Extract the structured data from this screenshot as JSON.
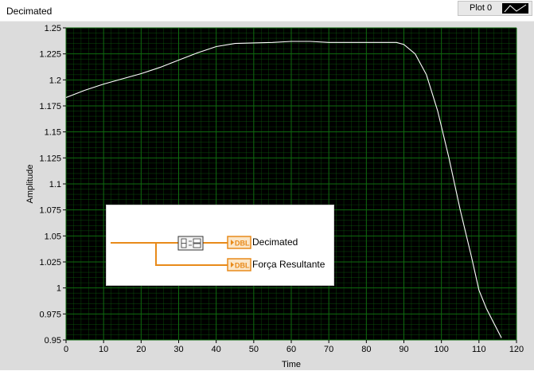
{
  "graph": {
    "title": "Decimated",
    "legend": {
      "plot_name": "Plot 0",
      "swatch_icon": "line-plot-swatch-icon"
    },
    "colors": {
      "plot_bg": "#000000",
      "grid": "#0f6b0f",
      "trace": "#ffffff",
      "wire": "#e88a1a"
    }
  },
  "chart_data": {
    "type": "line",
    "title": "Decimated",
    "xlabel": "Time",
    "ylabel": "Amplitude",
    "xlim": [
      0,
      120
    ],
    "ylim": [
      0.95,
      1.25
    ],
    "xticks": [
      "0",
      "10",
      "20",
      "30",
      "40",
      "50",
      "60",
      "70",
      "80",
      "90",
      "100",
      "110",
      "120"
    ],
    "yticks": [
      "1.25",
      "1.225",
      "1.2",
      "1.175",
      "1.15",
      "1.125",
      "1.1",
      "1.075",
      "1.05",
      "1.025",
      "1",
      "0.975",
      "0.95"
    ],
    "grid": true,
    "series": [
      {
        "x": [
          0,
          5,
          10,
          15,
          20,
          25,
          30,
          35,
          40,
          45,
          50,
          55,
          60,
          65,
          70,
          75,
          80,
          85,
          88,
          90,
          93,
          96,
          99,
          102,
          105,
          108,
          110,
          112,
          114,
          116
        ],
        "y": [
          1.183,
          1.19,
          1.196,
          1.201,
          1.206,
          1.212,
          1.219,
          1.226,
          1.232,
          1.235,
          1.2355,
          1.236,
          1.237,
          1.237,
          1.236,
          1.236,
          1.236,
          1.236,
          1.236,
          1.234,
          1.225,
          1.205,
          1.17,
          1.125,
          1.075,
          1.03,
          0.998,
          0.98,
          0.966,
          0.952
        ]
      }
    ]
  },
  "diagram": {
    "indicators": [
      {
        "name": "Decimated",
        "type": "DBL"
      },
      {
        "name": "Força Resultante",
        "type": "DBL"
      }
    ],
    "node_icon": "decimate-function-icon"
  }
}
